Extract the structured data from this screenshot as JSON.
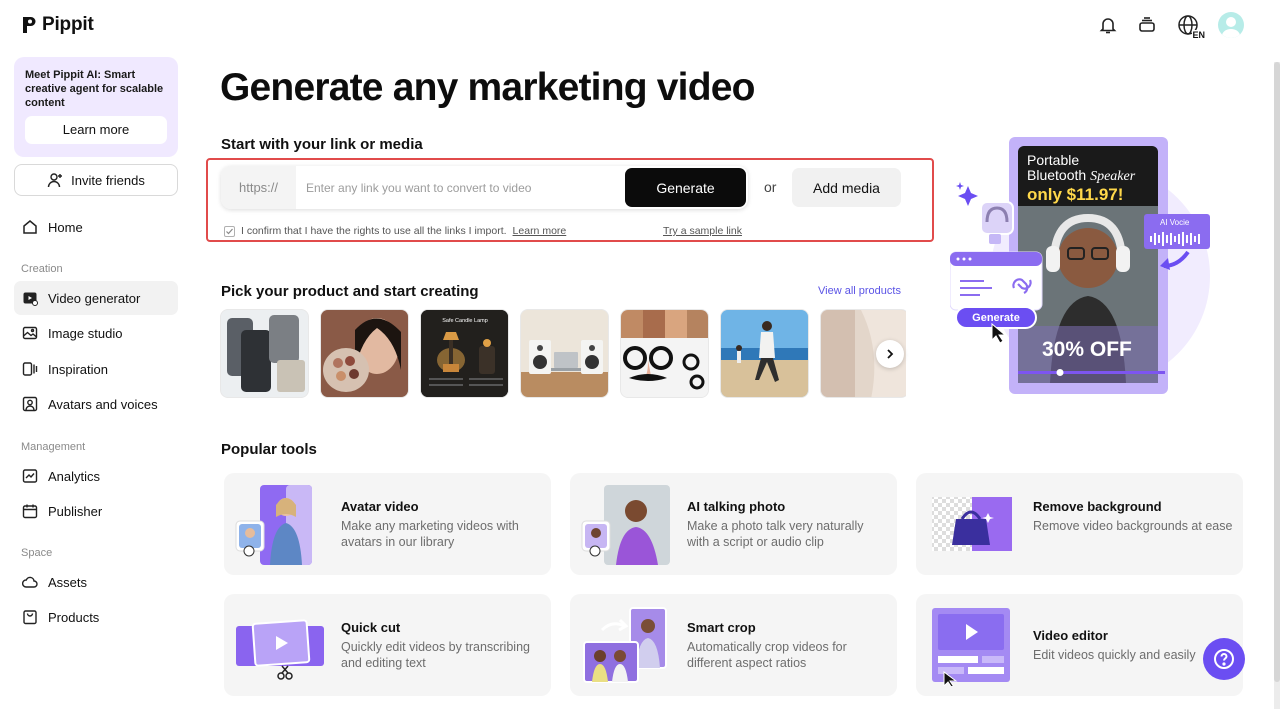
{
  "app": {
    "name": "Pippit"
  },
  "header": {
    "lang": "EN"
  },
  "sidebar": {
    "promo_text": "Meet Pippit AI: Smart creative agent for scalable content",
    "promo_button": "Learn more",
    "invite": "Invite friends",
    "home": "Home",
    "section_creation": "Creation",
    "creation": [
      "Video generator",
      "Image studio",
      "Inspiration",
      "Avatars and voices"
    ],
    "section_management": "Management",
    "management": [
      "Analytics",
      "Publisher"
    ],
    "section_space": "Space",
    "space": [
      "Assets",
      "Products"
    ],
    "active_item": "Video generator"
  },
  "main": {
    "title": "Generate any marketing video",
    "subtitle": "Start with your link or media",
    "link_prefix": "https://",
    "link_placeholder": "Enter any link you want to convert to video",
    "generate": "Generate",
    "or": "or",
    "add_media": "Add media",
    "confirm_text": "I confirm that I have the rights to use all the links I import.",
    "confirm_learn": "Learn more",
    "sample_link": "Try a sample link",
    "pick_title": "Pick your product and start creating",
    "view_all": "View all products",
    "thumb_candle_label": "Safe Candle Lamp",
    "popular_title": "Popular tools",
    "tools": [
      {
        "title": "Avatar video",
        "desc": "Make any marketing videos with avatars in our library"
      },
      {
        "title": "AI talking photo",
        "desc": "Make a photo talk very naturally with a script or audio clip"
      },
      {
        "title": "Remove background",
        "desc": "Remove video backgrounds at ease"
      },
      {
        "title": "Quick cut",
        "desc": "Quickly edit videos by transcribing and editing text"
      },
      {
        "title": "Smart crop",
        "desc": "Automatically crop videos for different aspect ratios"
      },
      {
        "title": "Video editor",
        "desc": "Edit videos quickly and easily"
      }
    ]
  },
  "hero": {
    "line1": "Portable",
    "line2": "Bluetooth ",
    "line2_italic": "Speaker",
    "price": "only $11.97!",
    "ai_voice": "AI Vocie",
    "generate": "Generate",
    "discount": "30% OFF"
  },
  "colors": {
    "accent": "#6b4ef2",
    "highlight": "#e14b4b",
    "promo_bg": "#f0e9ff"
  }
}
